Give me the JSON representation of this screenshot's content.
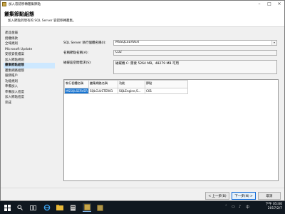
{
  "window": {
    "title": "加入容錯移轉叢集節點"
  },
  "header": {
    "title": "叢集節點組態",
    "subtitle": "加入節點到現有的 SQL Server 容錯移轉叢集。"
  },
  "nav": {
    "items": [
      {
        "label": "產品金鑰",
        "active": false
      },
      {
        "label": "授權條款",
        "active": false
      },
      {
        "label": "全域規則",
        "active": false
      },
      {
        "label": "Microsoft Update",
        "active": false
      },
      {
        "label": "安裝安裝檔案",
        "active": false
      },
      {
        "label": "加入節點規則",
        "active": false
      },
      {
        "label": "叢集節點組態",
        "active": true
      },
      {
        "label": "叢集網路組態",
        "active": false
      },
      {
        "label": "服務帳戶",
        "active": false
      },
      {
        "label": "功能規則",
        "active": false
      },
      {
        "label": "準備加入",
        "active": false
      },
      {
        "label": "準備加入進度",
        "active": false
      },
      {
        "label": "加入節點進度",
        "active": false
      },
      {
        "label": "完成",
        "active": false
      }
    ]
  },
  "form": {
    "instance_label": "SQL Server 執行個體名稱(I):",
    "instance_value": "MSSQLSERVER",
    "node_label": "名稱節點名稱(A):",
    "node_value": "C02",
    "disk_label": "磁碟區空間需求(S):",
    "disk_value": "磁碟機 C: 需要 5264 MB，48279 MB 可用"
  },
  "table": {
    "headers": [
      "執行個體名稱",
      "叢集網路名稱",
      "功能",
      "節點"
    ],
    "rows": [
      [
        "MSSQLSERVER",
        "SQLCLUSTER01",
        "SQLEngine,S...",
        "C01"
      ]
    ]
  },
  "buttons": {
    "back": "< 上一步(B)",
    "next": "下一步(N) >",
    "cancel": "取消"
  },
  "taskbar": {
    "time": "下午 05:00",
    "date": "2017/2/7"
  }
}
